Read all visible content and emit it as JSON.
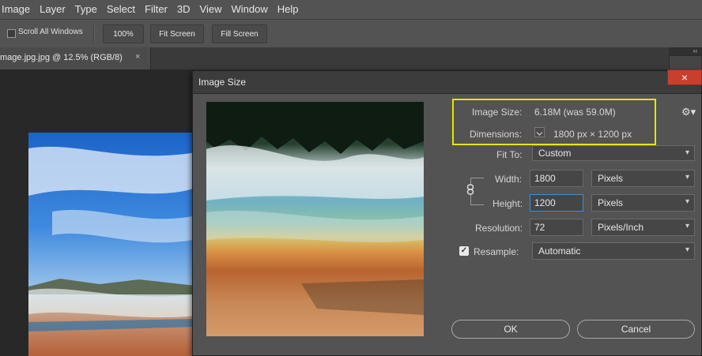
{
  "menu": [
    "Image",
    "Layer",
    "Type",
    "Select",
    "Filter",
    "3D",
    "View",
    "Window",
    "Help"
  ],
  "options": {
    "scroll_all_windows": "Scroll All Windows",
    "zoom_100": "100%",
    "fit_screen": "Fit Screen",
    "fill_screen": "Fill Screen"
  },
  "tab": {
    "label": "mage.jpg.jpg @ 12.5% (RGB/8)",
    "close": "×"
  },
  "panel": {
    "collapse": "‹‹"
  },
  "dialog": {
    "title": "Image Size",
    "close": "×",
    "image_size_label": "Image Size:",
    "image_size_value": "6.18M (was 59.0M)",
    "dimensions_label": "Dimensions:",
    "dimensions_value": "1800 px  ×  1200 px",
    "fit_to_label": "Fit To:",
    "fit_to_value": "Custom",
    "width_label": "Width:",
    "width_value": "1800",
    "width_unit": "Pixels",
    "height_label": "Height:",
    "height_value": "1200",
    "height_unit": "Pixels",
    "resolution_label": "Resolution:",
    "resolution_value": "72",
    "resolution_unit": "Pixels/Inch",
    "resample_label": "Resample:",
    "resample_checked": true,
    "resample_value": "Automatic",
    "ok": "OK",
    "cancel": "Cancel"
  },
  "icons": {
    "close": "close-icon",
    "gear": "gear-icon",
    "chevron": "chevron-down-icon",
    "link": "link-icon",
    "checkbox": "checkbox-icon"
  },
  "colors": {
    "highlight": "#e6e600",
    "close_button": "#c7402e",
    "focus": "#3d8fd6"
  }
}
